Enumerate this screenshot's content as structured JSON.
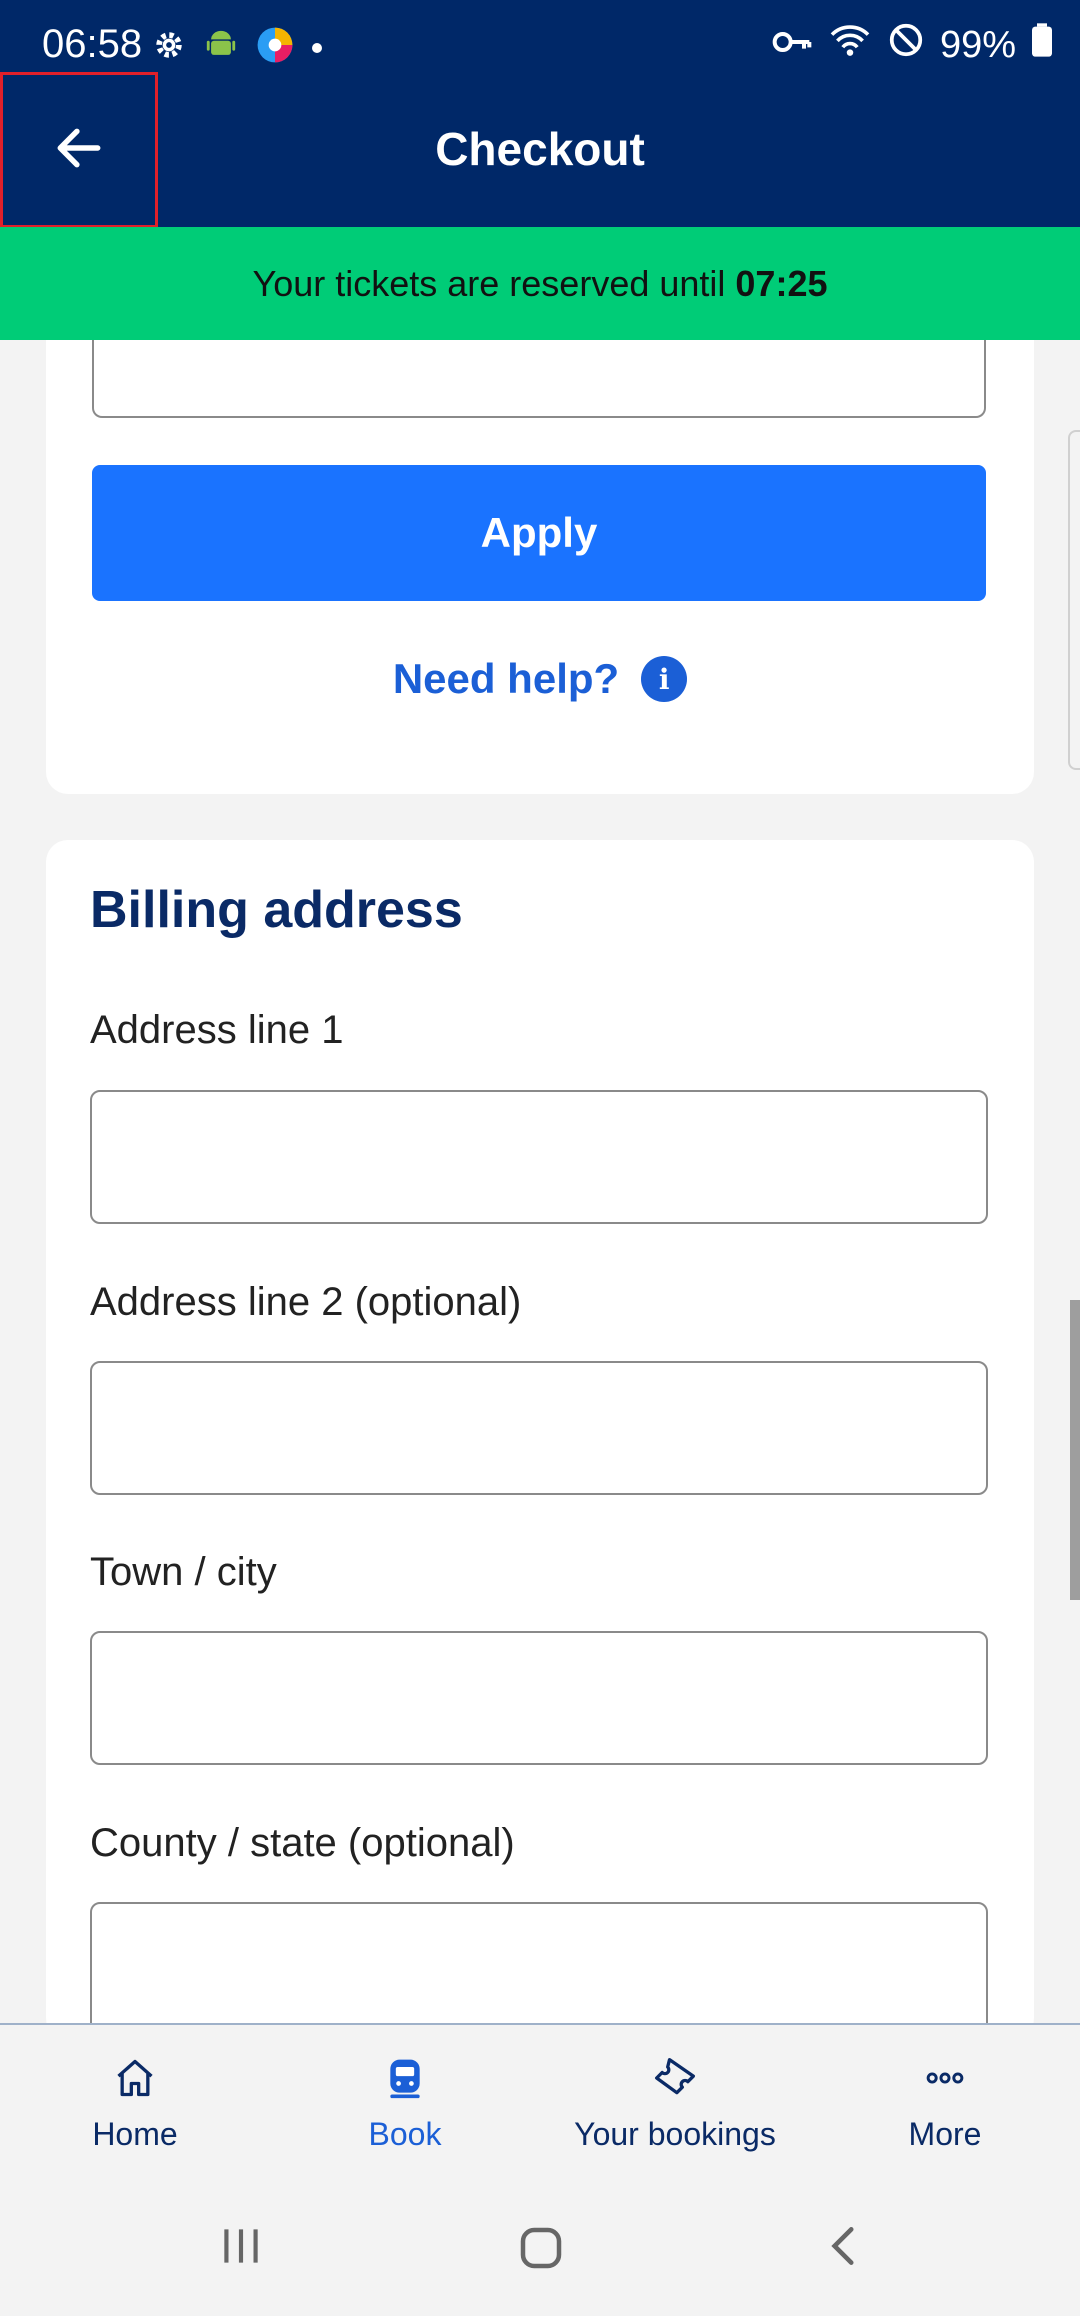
{
  "status_bar": {
    "time": "06:58",
    "battery": "99%",
    "icons_left": [
      "gear-icon",
      "android-icon",
      "edge-browser-icon",
      "dot-icon"
    ],
    "icons_right": [
      "key-icon",
      "wifi-icon",
      "do-not-disturb-icon",
      "battery-icon"
    ]
  },
  "header": {
    "title": "Checkout",
    "back_icon": "arrow-left-icon"
  },
  "banner": {
    "text": "Your tickets are reserved until",
    "time": "07:25"
  },
  "promo": {
    "apply_label": "Apply",
    "help_label": "Need help?",
    "help_icon": "info-icon"
  },
  "billing": {
    "heading": "Billing address",
    "fields": [
      {
        "label": "Address line 1",
        "value": ""
      },
      {
        "label": "Address line 2 (optional)",
        "value": ""
      },
      {
        "label": "Town / city",
        "value": ""
      },
      {
        "label": "County / state (optional)",
        "value": ""
      }
    ]
  },
  "bottom_nav": {
    "items": [
      {
        "label": "Home",
        "icon": "home-icon",
        "active": false
      },
      {
        "label": "Book",
        "icon": "train-icon",
        "active": true
      },
      {
        "label": "Your bookings",
        "icon": "ticket-icon",
        "active": false
      },
      {
        "label": "More",
        "icon": "more-dots-icon",
        "active": false
      }
    ]
  },
  "colors": {
    "primary_navy": "#002868",
    "banner_green": "#00cc77",
    "button_blue": "#1a73ff",
    "link_blue": "#1b5fd6"
  }
}
